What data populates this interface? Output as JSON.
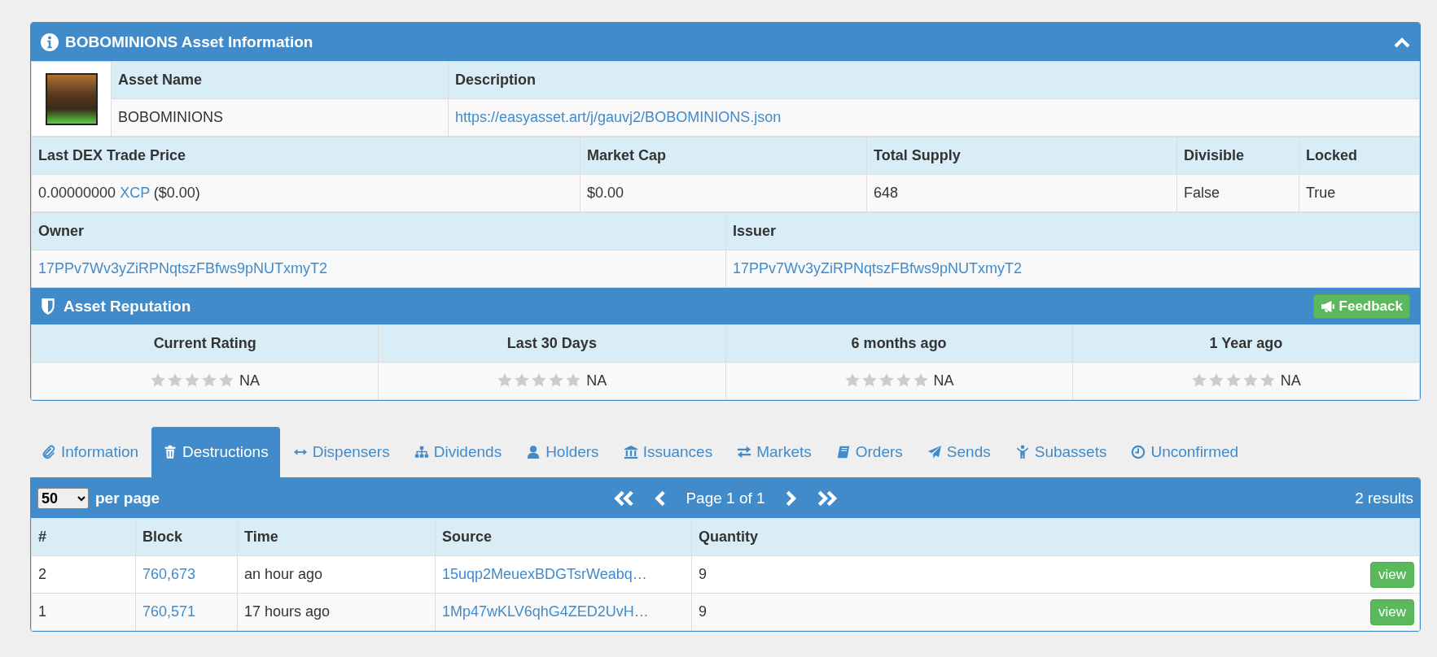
{
  "asset_panel": {
    "title": "BOBOMINIONS Asset Information",
    "expanded": true,
    "name": {
      "label": "Asset Name",
      "value": "BOBOMINIONS"
    },
    "description": {
      "label": "Description",
      "value": "https://easyasset.art/j/gauvj2/BOBOMINIONS.json"
    },
    "stats": [
      {
        "label": "Last DEX Trade Price",
        "value": "0.00000000",
        "link": "XCP",
        "note": "($0.00)"
      },
      {
        "label": "Market Cap",
        "value": "$0.00"
      },
      {
        "label": "Total Supply",
        "value": "648"
      },
      {
        "label": "Divisible",
        "value": "False"
      },
      {
        "label": "Locked",
        "value": "True"
      }
    ],
    "addresses": [
      {
        "label": "Owner",
        "value": "17PPv7Wv3yZiRPNqtszFBfws9pNUTxmyT2"
      },
      {
        "label": "Issuer",
        "value": "17PPv7Wv3yZiRPNqtszFBfws9pNUTxmyT2"
      }
    ]
  },
  "reputation": {
    "title": "Asset Reputation",
    "feedback_button": "Feedback",
    "ratings": [
      {
        "label": "Current Rating",
        "stars": 0,
        "value": "NA"
      },
      {
        "label": "Last 30 Days",
        "stars": 0,
        "value": "NA"
      },
      {
        "label": "6 months ago",
        "stars": 0,
        "value": "NA"
      },
      {
        "label": "1 Year ago",
        "stars": 0,
        "value": "NA"
      }
    ]
  },
  "tabs": [
    {
      "label": "Information",
      "selected": false
    },
    {
      "label": "Destructions",
      "selected": true
    },
    {
      "label": "Dispensers",
      "selected": false
    },
    {
      "label": "Dividends",
      "selected": false
    },
    {
      "label": "Holders",
      "selected": false
    },
    {
      "label": "Issuances",
      "selected": false
    },
    {
      "label": "Markets",
      "selected": false
    },
    {
      "label": "Orders",
      "selected": false
    },
    {
      "label": "Sends",
      "selected": false
    },
    {
      "label": "Subassets",
      "selected": false
    },
    {
      "label": "Unconfirmed",
      "selected": false
    }
  ],
  "results": {
    "per_page": "50",
    "per_page_label": "per page",
    "page": "Page 1 of 1",
    "count": "2 results",
    "columns": [
      "#",
      "Block",
      "Time",
      "Source",
      "Quantity"
    ],
    "rows": [
      {
        "cells": [
          "2",
          "760,673",
          "an hour ago",
          "15uqp2MeuexBDGTsrWeabq…",
          "9"
        ],
        "action": "view"
      },
      {
        "cells": [
          "1",
          "760,571",
          "17 hours ago",
          "1Mp47wKLV6qhG4ZED2UvH…",
          "9"
        ],
        "action": "view"
      }
    ]
  }
}
